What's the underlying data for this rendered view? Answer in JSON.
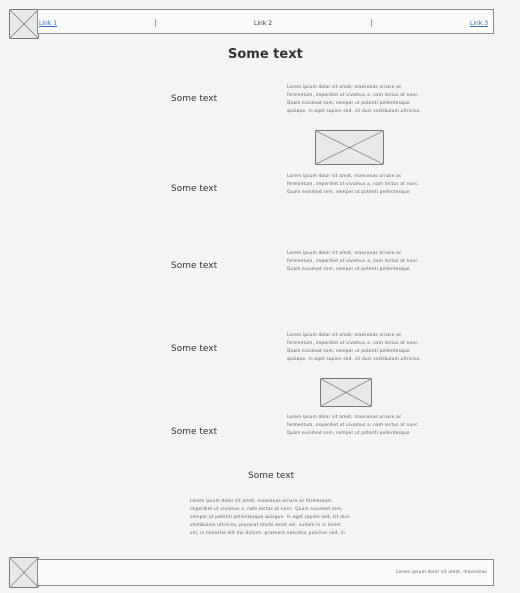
{
  "header": {
    "links": [
      "Link 1",
      "Link 2",
      "Link 3"
    ]
  },
  "main": {
    "title": "Some text",
    "rows": [
      {
        "label": "Some text",
        "lines": [
          "Lorem ipsum dolor sit amet, maecenas ornare ac",
          "fermentum, imperdiet ut vivamus a, nam lectus at nunc.",
          "Quam euismod sem, semper ut potenti pellentesque",
          "quisque. In eget sapien sed, sit duis vestibulum ultricies."
        ]
      },
      {
        "label": "Some text",
        "lines": [
          "Lorem ipsum dolor sit amet, maecenas ornare ac",
          "fermentum, imperdiet ut vivamus a, nam lectus at nunc.",
          "Quam euismod sem, semper ut potenti pellentesque"
        ]
      },
      {
        "label": "Some text",
        "lines": [
          "Lorem ipsum dolor sit amet, maecenas ornare ac",
          "fermentum, imperdiet ut vivamus a, nam lectus at nunc.",
          "Quam euismod sem, semper ut potenti pellentesque"
        ]
      },
      {
        "label": "Some text",
        "lines": [
          "Lorem ipsum dolor sit amet, maecenas ornare ac",
          "fermentum, imperdiet ut vivamus a, nam lectus at nunc.",
          "Quam euismod sem, semper ut potenti pellentesque",
          "quisque. In eget sapien sed, sit duis vestibulum ultricies."
        ]
      },
      {
        "label": "Some text",
        "lines": [
          "Lorem ipsum dolor sit amet, maecenas ornare ac",
          "fermentum, imperdiet ut vivamus a, nam lectus at nunc.",
          "Quam euismod sem, semper ut potenti pellentesque"
        ]
      }
    ],
    "bottom_label": "Some text",
    "bottom_lines": [
      "Lorem ipsum dolor sit amet, maecenas ornare ac fermentum,",
      "imperdiet ut vivamus a, nam lectus at nunc. Quam euismod sem,",
      "semper ut potenti pellentesque quisque. In eget sapien sed, sit duis",
      "vestibulum ultricies, placerat morbi amet vel, nullam in in lorem",
      "vel, in molestie elit dui dictum, praesent nascetur pulvinar sed, in"
    ]
  },
  "footer": {
    "text": "Lorem ipsum dolor sit amet, maecenas"
  }
}
